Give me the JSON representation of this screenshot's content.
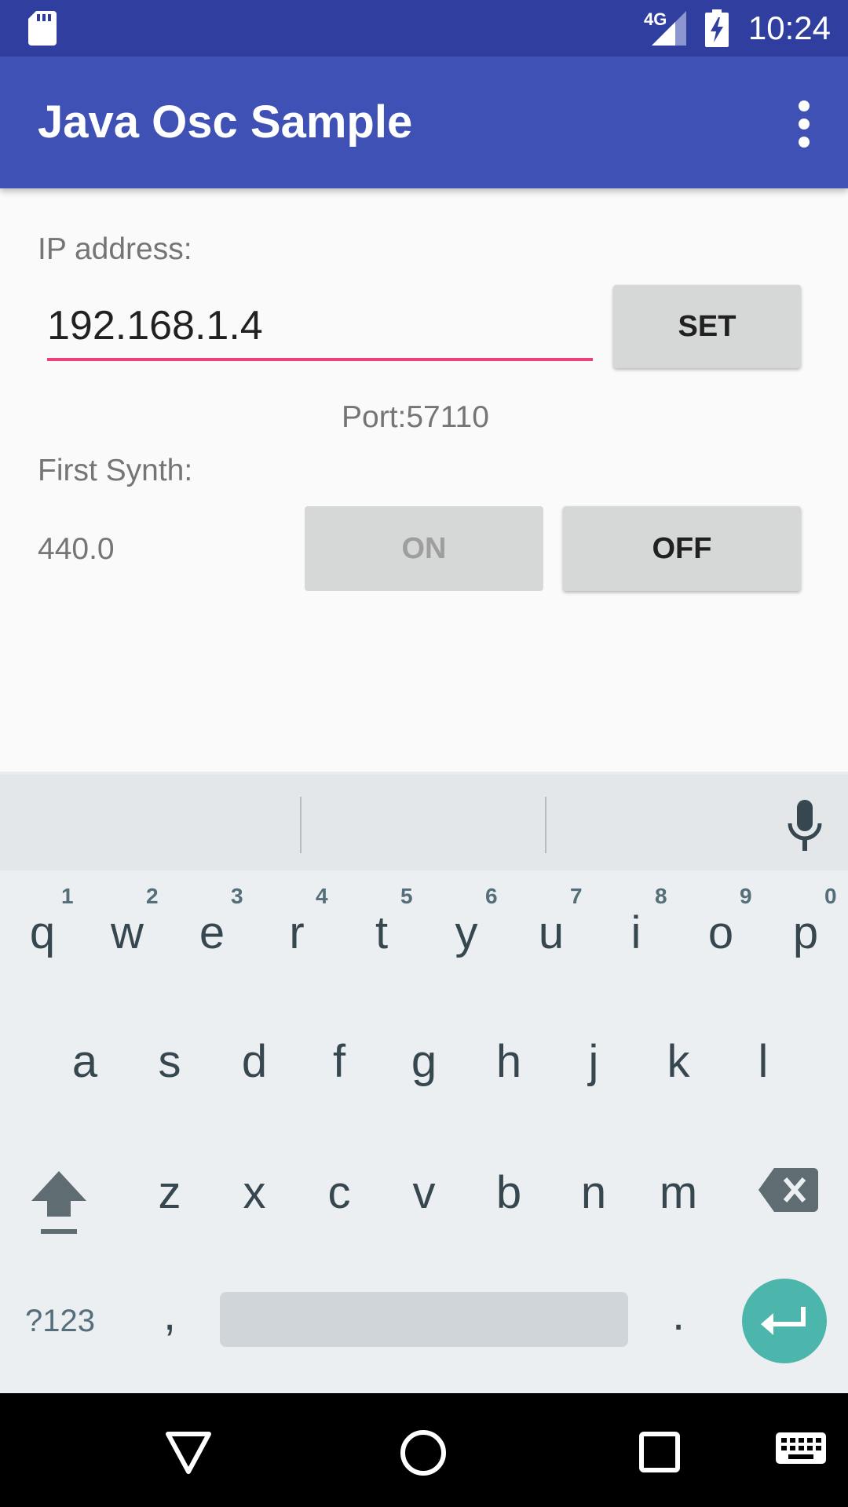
{
  "status_bar": {
    "time": "10:24",
    "network": "4G",
    "icons": [
      "sd-card-icon",
      "signal-icon",
      "battery-charging-icon"
    ]
  },
  "app_bar": {
    "title": "Java Osc Sample",
    "menu_icon": "overflow-menu-icon"
  },
  "main": {
    "ip_label": "IP address:",
    "ip_value": "192.168.1.4",
    "set_button": "SET",
    "port_text": "Port:57110",
    "synth_label": "First Synth:",
    "frequency": "440.0",
    "on_button": "ON",
    "off_button": "OFF"
  },
  "keyboard": {
    "row1": [
      "q",
      "w",
      "e",
      "r",
      "t",
      "y",
      "u",
      "i",
      "o",
      "p"
    ],
    "row1_hints": [
      "1",
      "2",
      "3",
      "4",
      "5",
      "6",
      "7",
      "8",
      "9",
      "0"
    ],
    "row2": [
      "a",
      "s",
      "d",
      "f",
      "g",
      "h",
      "j",
      "k",
      "l"
    ],
    "row3": [
      "z",
      "x",
      "c",
      "v",
      "b",
      "n",
      "m"
    ],
    "symbols_key": "?123",
    "comma_key": ",",
    "period_key": "."
  },
  "colors": {
    "status_bar": "#303f9f",
    "app_bar": "#3f51b5",
    "accent": "#ec407a",
    "enter_key": "#4db6ac"
  }
}
